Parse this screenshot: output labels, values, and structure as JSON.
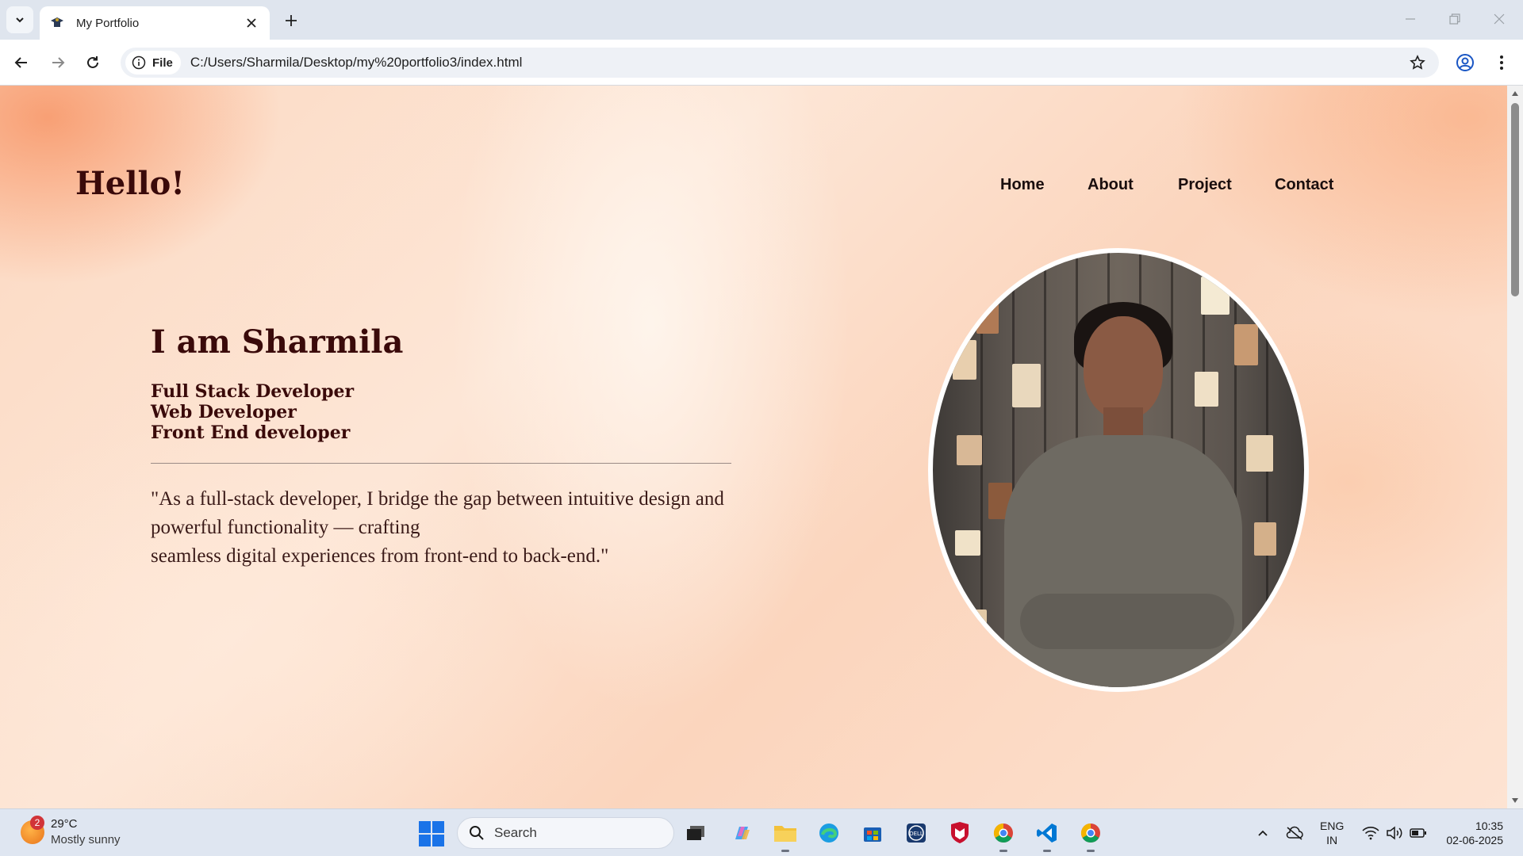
{
  "browser": {
    "tab_title": "My Portfolio",
    "url_chip": "File",
    "url": "C:/Users/Sharmila/Desktop/my%20portfolio3/index.html"
  },
  "page": {
    "brand": "Hello!",
    "nav": [
      "Home",
      "About",
      "Project",
      "Contact"
    ],
    "hero_name": "I am Sharmila",
    "roles": [
      "Full Stack Developer",
      "Web Developer",
      "Front End developer"
    ],
    "quote_lines": [
      "\"As a full-stack developer, I bridge the gap between intuitive design and",
      "powerful functionality — crafting",
      "seamless digital experiences from front-end to back-end.\""
    ],
    "colors": {
      "heading": "#3a0a0a",
      "background": "#fde6d6"
    }
  },
  "taskbar": {
    "weather_badge": "2",
    "weather_temp": "29°C",
    "weather_desc": "Mostly sunny",
    "search_placeholder": "Search",
    "lang_1": "ENG",
    "lang_2": "IN",
    "time": "10:35",
    "date": "02-06-2025",
    "icons": [
      "task-view-icon",
      "copilot-icon",
      "file-explorer-icon",
      "edge-icon",
      "store-icon",
      "dell-icon",
      "mcafee-icon",
      "chrome-icon",
      "vscode-icon",
      "chrome-icon"
    ]
  }
}
